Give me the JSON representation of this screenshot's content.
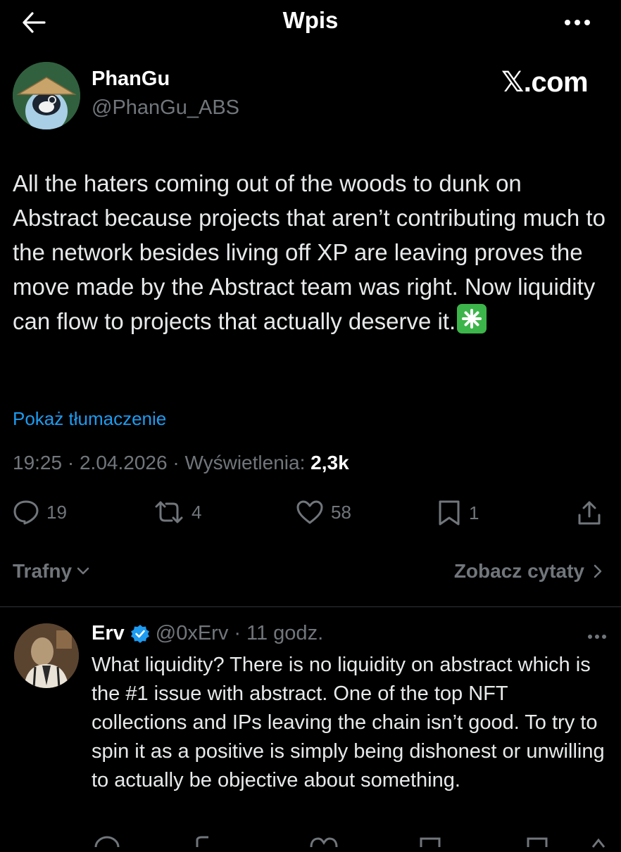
{
  "header": {
    "title": "Wpis"
  },
  "author": {
    "name": "PhanGu",
    "handle": "@PhanGu_ABS"
  },
  "watermark": "𝕏.com",
  "tweet": {
    "text": "All the haters coming out of the woods to dunk on Abstract because projects that aren’t contributing much to the network besides living off XP are leaving proves the move made by the Abstract team was right. Now liquidity can flow to projects that actually deserve it.",
    "emoji": "sparkle-emoji",
    "translate_label": "Pokaż tłumaczenie",
    "time": "19:25",
    "date": "2.04.2026",
    "views_label": "Wyświetlenia:",
    "views_count": "2,3k",
    "sep": "·"
  },
  "actions": {
    "replies": "19",
    "reposts": "4",
    "likes": "58",
    "bookmarks": "1"
  },
  "sort": {
    "label": "Trafny",
    "quotes_label": "Zobacz cytaty"
  },
  "reply": {
    "name": "Erv",
    "handle": "@0xErv",
    "sep": "·",
    "time": "11 godz.",
    "text": "What liquidity? There is no liquidity on abstract which is the #1 issue with abstract. One of the top NFT collections and IPs leaving the chain isn’t good. To try to spin it as a positive is simply being dishonest or unwilling to actually be objective about something."
  },
  "colors": {
    "accent": "#1d9bf0",
    "muted": "#71767b",
    "verified": "#1d9bf0",
    "emoji_bg": "#3cb54a"
  }
}
